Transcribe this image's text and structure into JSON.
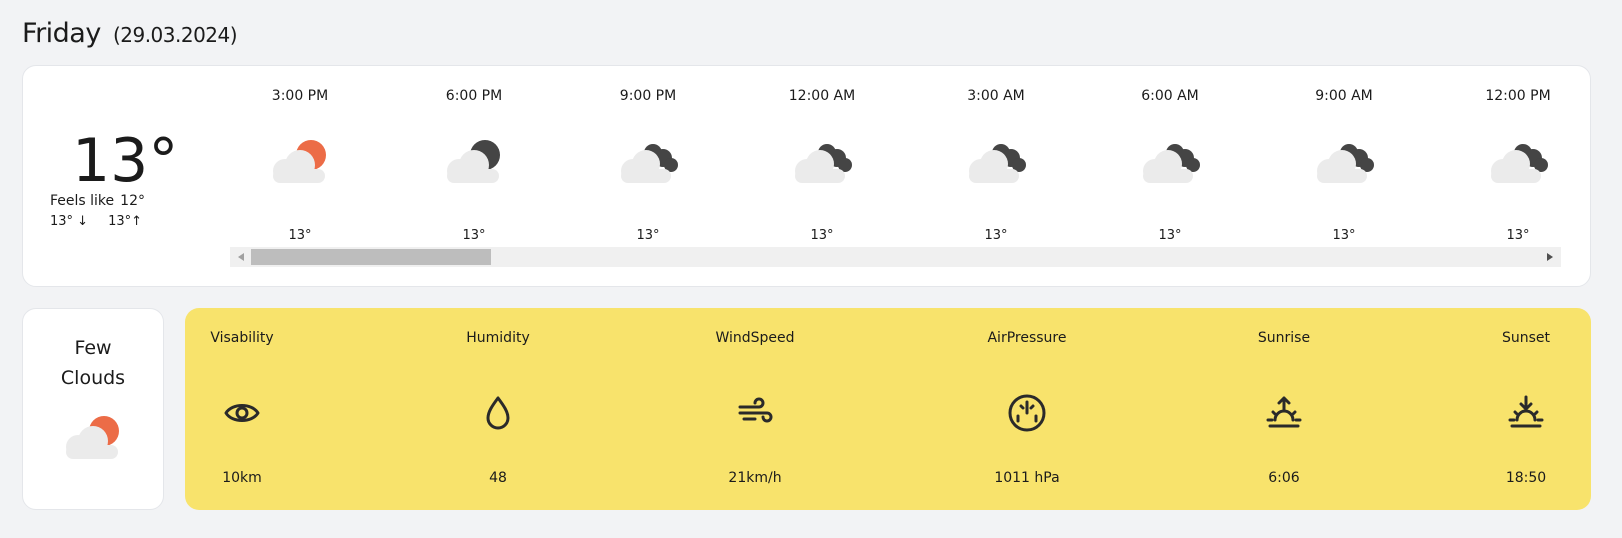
{
  "header": {
    "day": "Friday",
    "date": "(29.03.2024)"
  },
  "current": {
    "temp": "13°",
    "feels_label": "Feels like",
    "feels_value": "12°",
    "min": "13° ↓",
    "max": "13°↑"
  },
  "hourly": [
    {
      "time": "3:00 PM",
      "icon": "cloud-sun-icon",
      "temp": "13°"
    },
    {
      "time": "6:00 PM",
      "icon": "cloud-moon-icon",
      "temp": "13°"
    },
    {
      "time": "9:00 PM",
      "icon": "cloudy-night-icon",
      "temp": "13°"
    },
    {
      "time": "12:00 AM",
      "icon": "cloudy-night-icon",
      "temp": "13°"
    },
    {
      "time": "3:00 AM",
      "icon": "cloudy-night-icon",
      "temp": "13°"
    },
    {
      "time": "6:00 AM",
      "icon": "cloudy-night-icon",
      "temp": "13°"
    },
    {
      "time": "9:00 AM",
      "icon": "cloudy-night-icon",
      "temp": "13°"
    },
    {
      "time": "12:00 PM",
      "icon": "cloudy-night-icon",
      "temp": "13°"
    }
  ],
  "condition": {
    "text": "Few Clouds",
    "icon": "cloud-sun-icon"
  },
  "details": [
    {
      "label": "Visability",
      "value": "10km",
      "icon": "eye-icon"
    },
    {
      "label": "Humidity",
      "value": "48",
      "icon": "droplet-icon"
    },
    {
      "label": "WindSpeed",
      "value": "21km/h",
      "icon": "wind-icon"
    },
    {
      "label": "AirPressure",
      "value": "1011 hPa",
      "icon": "gauge-icon"
    },
    {
      "label": "Sunrise",
      "value": "6:06",
      "icon": "sunrise-icon"
    },
    {
      "label": "Sunset",
      "value": "18:50",
      "icon": "sunset-icon"
    }
  ],
  "colors": {
    "accent_sun": "#ec6c47",
    "cloud_light": "#e9e9e9",
    "cloud_dark": "#454545",
    "details_bg": "#f8e36c",
    "background": "#f2f3f5"
  }
}
